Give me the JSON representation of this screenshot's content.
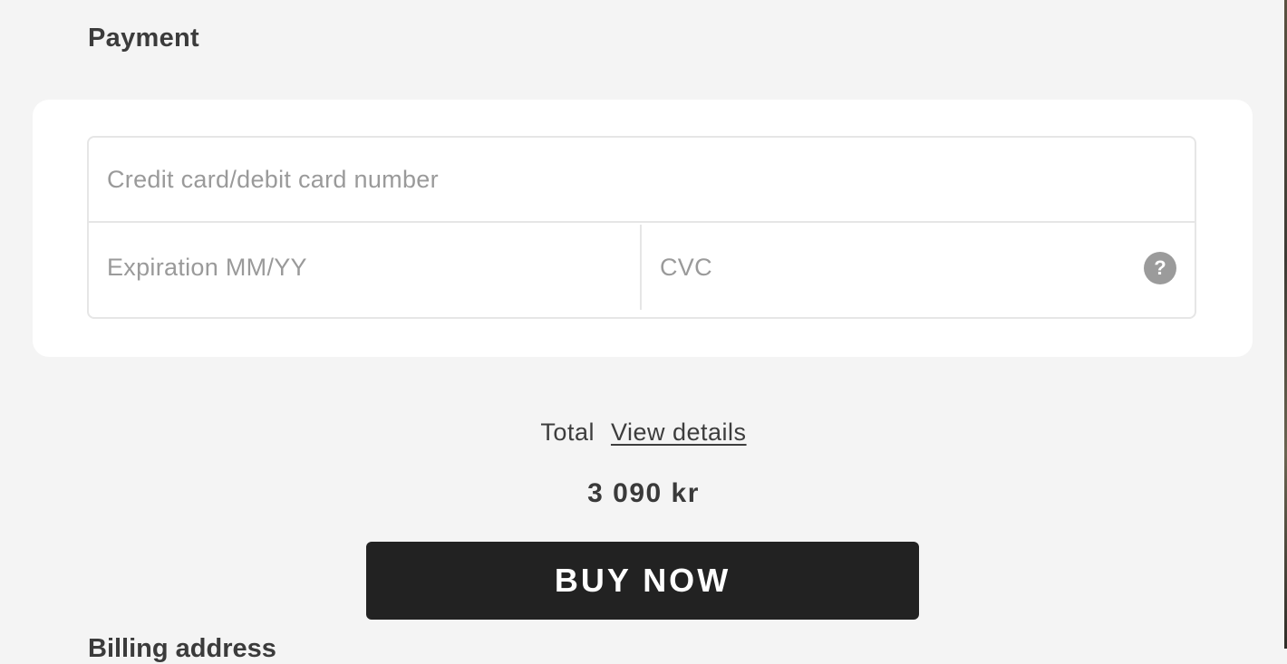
{
  "payment": {
    "title": "Payment",
    "fields": {
      "card_number_placeholder": "Credit card/debit card number",
      "expiration_placeholder": "Expiration MM/YY",
      "cvc_placeholder": "CVC",
      "help_icon_glyph": "?",
      "help_icon": "question-circle-icon"
    }
  },
  "summary": {
    "total_label": "Total",
    "view_details_label": "View details",
    "amount": "3 090 kr"
  },
  "buy_button_label": "BUY NOW",
  "next_section_title": "Billing address",
  "colors": {
    "page_background": "#f4f4f4",
    "card_background": "#ffffff",
    "button_background": "#222222",
    "placeholder_text": "#9a9a9a",
    "help_icon": "#9b9b9b"
  }
}
